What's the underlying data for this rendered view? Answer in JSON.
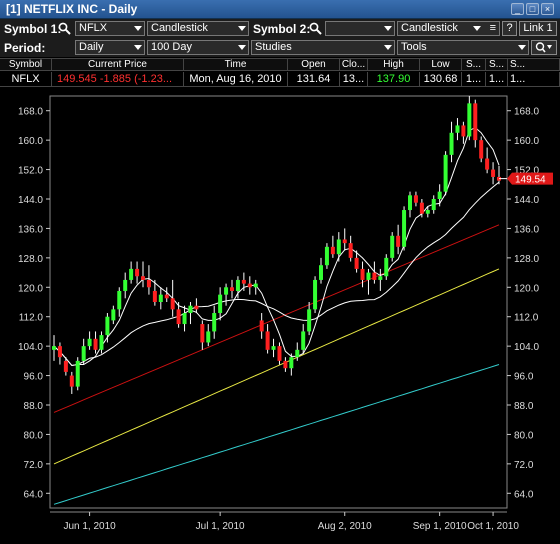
{
  "window": {
    "title": "[1] NETFLIX INC - Daily"
  },
  "toolbar1": {
    "symbol1_label": "Symbol 1:",
    "symbol1_value": "NFLX",
    "chart_type1": "Candlestick",
    "symbol2_label": "Symbol 2:",
    "symbol2_value": "",
    "chart_type2": "Candlestick",
    "help": "?",
    "link": "Link 1"
  },
  "toolbar2": {
    "period_label": "Period:",
    "period_value": "Daily",
    "range_value": "100 Day",
    "studies_value": "Studies",
    "tools_value": "Tools"
  },
  "quote": {
    "headers": [
      "Symbol",
      "Current Price",
      "Time",
      "Open",
      "Clo...",
      "High",
      "Low",
      "S...",
      "S...",
      "S..."
    ],
    "symbol": "NFLX",
    "price": "149.545",
    "change": "-1.885",
    "change_pct": "(-1.23...",
    "time": "Mon, Aug 16, 2010",
    "open": "131.64",
    "close": "13...",
    "high": "137.90",
    "low": "130.68",
    "s1": "1...",
    "s2": "1...",
    "s3": "1..."
  },
  "colors": {
    "up": "#33ff33",
    "down": "#ff2020",
    "ma_white": "#ffffff",
    "ma_red": "#cc1111",
    "ma_yellow": "#e8e844",
    "ma_cyan": "#33cccc",
    "price_tag": "#e01818"
  },
  "chart_data": {
    "type": "candlestick",
    "y_ticks": [
      "168.0",
      "160.0",
      "152.0",
      "144.0",
      "136.0",
      "128.0",
      "120.0",
      "112.0",
      "104.0",
      "96.0",
      "88.0",
      "80.0",
      "72.0",
      "64.0"
    ],
    "x_ticks": [
      "Jun 1, 2010",
      "Jul 1, 2010",
      "Aug 2, 2010",
      "Sep 1, 2010",
      "Oct 1, 2010"
    ],
    "ylim": [
      60,
      174
    ],
    "current_price_label": "149.54",
    "current_price": 149.54,
    "candles": [
      [
        103,
        107,
        100,
        104
      ],
      [
        104,
        105,
        99,
        101
      ],
      [
        100,
        101,
        96,
        97
      ],
      [
        96,
        97,
        91,
        93
      ],
      [
        93,
        101,
        92,
        100
      ],
      [
        100,
        106,
        99,
        104
      ],
      [
        104,
        108,
        103,
        106
      ],
      [
        106,
        108,
        102,
        103
      ],
      [
        103,
        108,
        102,
        107
      ],
      [
        107,
        113,
        105,
        112
      ],
      [
        111,
        115,
        110,
        114
      ],
      [
        114,
        120,
        112,
        119
      ],
      [
        119,
        124,
        117,
        122
      ],
      [
        122,
        127,
        121,
        125
      ],
      [
        125,
        127,
        121,
        123
      ],
      [
        123,
        127,
        120,
        122
      ],
      [
        122,
        126,
        118,
        120
      ],
      [
        119,
        122,
        115,
        116
      ],
      [
        116,
        120,
        114,
        118
      ],
      [
        118,
        120,
        116,
        117
      ],
      [
        117,
        122,
        112,
        114
      ],
      [
        114,
        116,
        109,
        110
      ],
      [
        110,
        115,
        108,
        113
      ],
      [
        113,
        116,
        110,
        115
      ],
      [
        115,
        117,
        113,
        114
      ],
      [
        110,
        111,
        103,
        105
      ],
      [
        105,
        110,
        104,
        108
      ],
      [
        108,
        115,
        106,
        113
      ],
      [
        113,
        120,
        111,
        118
      ],
      [
        118,
        121,
        115,
        120
      ],
      [
        120,
        122,
        117,
        119
      ],
      [
        119,
        123,
        117,
        122
      ],
      [
        122,
        124,
        119,
        121
      ],
      [
        121,
        123,
        118,
        120
      ],
      [
        120,
        122,
        118,
        121
      ],
      [
        111,
        113,
        106,
        108
      ],
      [
        108,
        110,
        102,
        103
      ],
      [
        103,
        106,
        101,
        104
      ],
      [
        104,
        105,
        99,
        100
      ],
      [
        100,
        101,
        97,
        98
      ],
      [
        98,
        102,
        96,
        101
      ],
      [
        101,
        105,
        100,
        103
      ],
      [
        103,
        110,
        102,
        108
      ],
      [
        108,
        116,
        107,
        114
      ],
      [
        114,
        123,
        113,
        122
      ],
      [
        122,
        128,
        121,
        126
      ],
      [
        126,
        132,
        125,
        131
      ],
      [
        131,
        134,
        128,
        129
      ],
      [
        129,
        135,
        127,
        133
      ],
      [
        133,
        136,
        130,
        132
      ],
      [
        132,
        134,
        127,
        128
      ],
      [
        128,
        130,
        124,
        125
      ],
      [
        125,
        127,
        120,
        122
      ],
      [
        122,
        125,
        118,
        124
      ],
      [
        124,
        127,
        121,
        122
      ],
      [
        122,
        125,
        119,
        123
      ],
      [
        123,
        129,
        122,
        128
      ],
      [
        128,
        135,
        127,
        134
      ],
      [
        134,
        137,
        129,
        131
      ],
      [
        131,
        142,
        130,
        141
      ],
      [
        141,
        146,
        139,
        145
      ],
      [
        145,
        146,
        142,
        143
      ],
      [
        143,
        144,
        139,
        140
      ],
      [
        140,
        142,
        139,
        141
      ],
      [
        141,
        145,
        140,
        144
      ],
      [
        144,
        148,
        142,
        146
      ],
      [
        146,
        157,
        145,
        156
      ],
      [
        156,
        165,
        154,
        162
      ],
      [
        162,
        166,
        160,
        164
      ],
      [
        164,
        165,
        159,
        161
      ],
      [
        161,
        172,
        160,
        170
      ],
      [
        170,
        171,
        158,
        160
      ],
      [
        160,
        161,
        154,
        155
      ],
      [
        155,
        158,
        151,
        152
      ],
      [
        152,
        154,
        148,
        150
      ],
      [
        150,
        153,
        148,
        149
      ]
    ]
  }
}
